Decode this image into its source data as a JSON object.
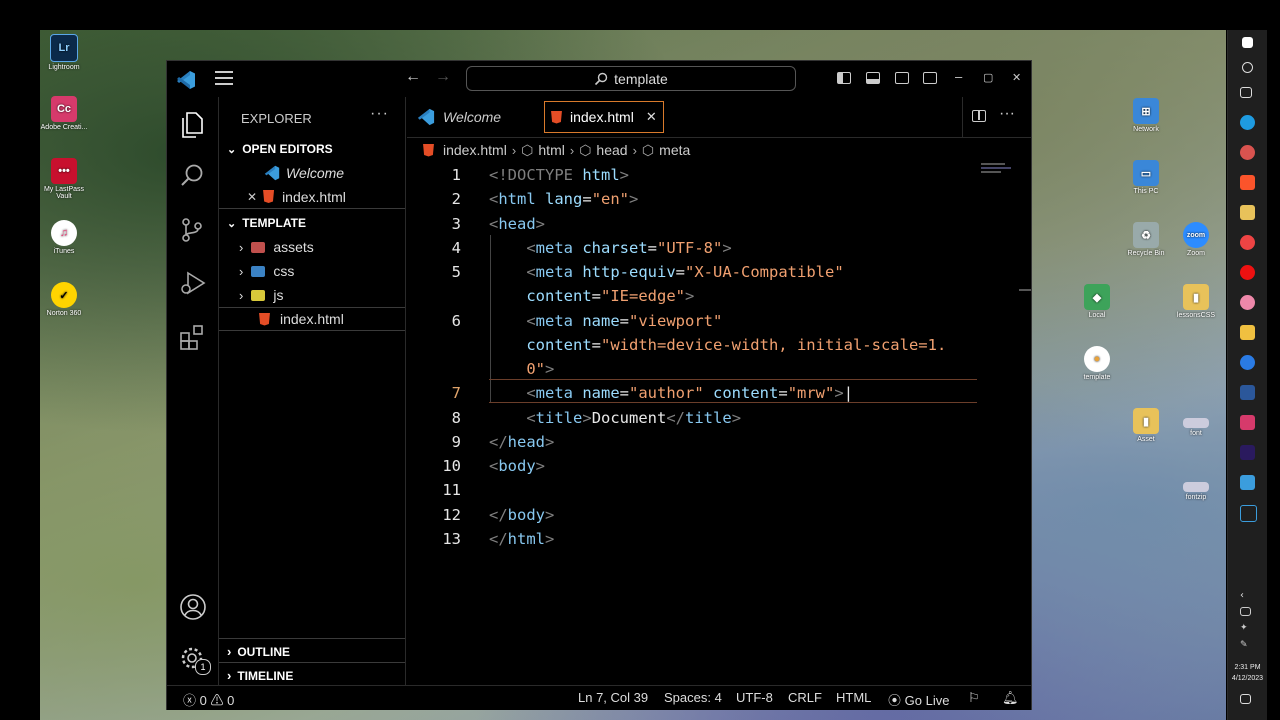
{
  "desktop": {
    "icons": [
      {
        "label": "Lightroom",
        "glyph": "Lr",
        "color": "#0b2a4a"
      },
      {
        "label": "Adobe Creati...",
        "glyph": "Cc",
        "color": "#d63a6b"
      },
      {
        "label": "My LastPass Vault",
        "glyph": "•••",
        "color": "#c8102e"
      },
      {
        "label": "iTunes",
        "glyph": "♫",
        "color": "#e8457c"
      },
      {
        "label": "Norton 360",
        "glyph": "✓",
        "color": "#ffd400"
      },
      {
        "label": "Network",
        "glyph": "⊞",
        "color": "#3a87d8"
      },
      {
        "label": "This PC",
        "glyph": "▭",
        "color": "#3a87d8"
      },
      {
        "label": "Recycle Bin",
        "glyph": "♻",
        "color": "#9aa"
      },
      {
        "label": "Zoom",
        "glyph": "zoom",
        "color": "#2d8cff"
      },
      {
        "label": "Local",
        "glyph": "◆",
        "color": "#3da35a"
      },
      {
        "label": "lessonsCSS",
        "glyph": "▮",
        "color": "#e8c25a"
      },
      {
        "label": "template",
        "glyph": "●",
        "color": "#e8a23a"
      },
      {
        "label": "Asset",
        "glyph": "▮",
        "color": "#e8c25a"
      },
      {
        "label": "font",
        "glyph": "▬",
        "color": "#ccd"
      },
      {
        "label": "fontzip",
        "glyph": "▬",
        "color": "#ccd"
      }
    ]
  },
  "taskbar": {
    "time": "2:31 PM",
    "date": "4/12/2023"
  },
  "window": {
    "search_text": "template",
    "minimize": "–",
    "maximize": "▢",
    "close": "✕"
  },
  "sidebar": {
    "title": "EXPLORER",
    "more": "···",
    "open_editors_title": "OPEN EDITORS",
    "open_editors": [
      {
        "label": "Welcome",
        "italic": true
      },
      {
        "label": "index.html",
        "italic": false
      }
    ],
    "folder_title": "TEMPLATE",
    "tree": [
      {
        "label": "assets",
        "kind": "folder"
      },
      {
        "label": "css",
        "kind": "folder"
      },
      {
        "label": "js",
        "kind": "folder"
      },
      {
        "label": "index.html",
        "kind": "file"
      }
    ],
    "outline_title": "OUTLINE",
    "timeline_title": "TIMELINE"
  },
  "activity": {
    "accounts_badge": "1"
  },
  "tabs": [
    {
      "label": "Welcome",
      "active": false
    },
    {
      "label": "index.html",
      "active": true
    }
  ],
  "breadcrumb": [
    "index.html",
    "html",
    "head",
    "meta"
  ],
  "code": {
    "lines": [
      {
        "n": "1",
        "html": "<span class='tg'>&lt;!DOCTYPE</span> <span class='an'>html</span><span class='tg'>&gt;</span>"
      },
      {
        "n": "2",
        "html": "<span class='tg'>&lt;</span><span class='tn'>html</span> <span class='an'>lang</span>=<span class='av'>\"en\"</span><span class='tg'>&gt;</span>"
      },
      {
        "n": "3",
        "html": "<span class='tg'>&lt;</span><span class='tn'>head</span><span class='tg'>&gt;</span>"
      },
      {
        "n": "4",
        "html": "    <span class='tg'>&lt;</span><span class='tn'>meta</span> <span class='an'>charset</span>=<span class='av'>\"UTF-8\"</span><span class='tg'>&gt;</span>"
      },
      {
        "n": "5",
        "html": "    <span class='tg'>&lt;</span><span class='tn'>meta</span> <span class='an'>http-equiv</span>=<span class='av'>\"X-UA-Compatible\"</span>"
      },
      {
        "n": "",
        "html": "    <span class='an'>content</span>=<span class='av'>\"IE=edge\"</span><span class='tg'>&gt;</span>"
      },
      {
        "n": "6",
        "html": "    <span class='tg'>&lt;</span><span class='tn'>meta</span> <span class='an'>name</span>=<span class='av'>\"viewport\"</span>"
      },
      {
        "n": "",
        "html": "    <span class='an'>content</span>=<span class='av'>\"width=device-width, initial-scale=1.</span>"
      },
      {
        "n": "",
        "html": "    <span class='av'>0\"</span><span class='tg'>&gt;</span>"
      },
      {
        "n": "7",
        "html": "    <span class='tg'>&lt;</span><span class='tn'>meta</span> <span class='an'>name</span>=<span class='av'>\"author\"</span> <span class='an'>content</span>=<span class='av'>\"mrw\"</span><span class='tg'>&gt;</span>|"
      },
      {
        "n": "8",
        "html": "    <span class='tg'>&lt;</span><span class='tn'>title</span><span class='tg'>&gt;</span>Document<span class='tg'>&lt;/</span><span class='tn'>title</span><span class='tg'>&gt;</span>"
      },
      {
        "n": "9",
        "html": "<span class='tg'>&lt;/</span><span class='tn'>head</span><span class='tg'>&gt;</span>"
      },
      {
        "n": "10",
        "html": "<span class='tg'>&lt;</span><span class='tn'>body</span><span class='tg'>&gt;</span>"
      },
      {
        "n": "11",
        "html": ""
      },
      {
        "n": "12",
        "html": "<span class='tg'>&lt;/</span><span class='tn'>body</span><span class='tg'>&gt;</span>"
      },
      {
        "n": "13",
        "html": "<span class='tg'>&lt;/</span><span class='tn'>html</span><span class='tg'>&gt;</span>"
      }
    ],
    "current_line": "7"
  },
  "status": {
    "errors": "0",
    "warnings": "0",
    "position": "Ln 7, Col 39",
    "spaces": "Spaces: 4",
    "encoding": "UTF-8",
    "eol": "CRLF",
    "language": "HTML",
    "golive": "Go Live"
  },
  "colors": {
    "accent_tab_border": "#d97a2b",
    "html_icon": "#e44d26",
    "vscode_blue": "#3b9ddd"
  }
}
